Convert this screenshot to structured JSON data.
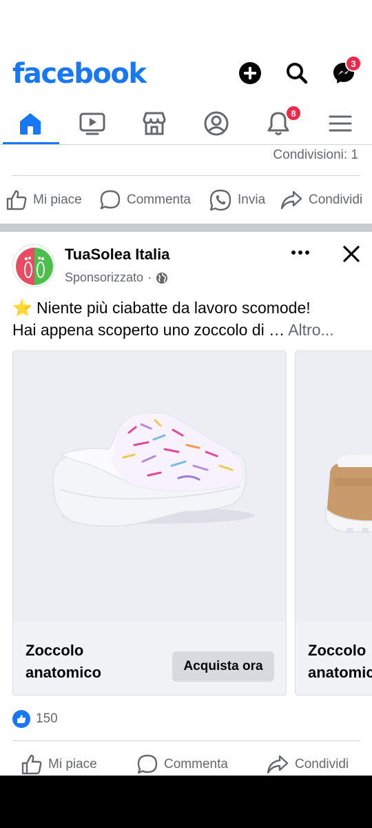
{
  "app": {
    "logo_text": "facebook",
    "brand_color": "#1877f2",
    "top_icons": [
      {
        "name": "create-post",
        "icon": "plus-circle-icon"
      },
      {
        "name": "search",
        "icon": "search-icon"
      },
      {
        "name": "messenger",
        "icon": "messenger-icon",
        "badge": "3"
      }
    ]
  },
  "nav": {
    "tabs": [
      {
        "name": "home",
        "icon": "home-icon",
        "active": true
      },
      {
        "name": "video",
        "icon": "video-icon"
      },
      {
        "name": "marketplace",
        "icon": "marketplace-icon"
      },
      {
        "name": "profile",
        "icon": "profile-icon"
      },
      {
        "name": "notifications",
        "icon": "bell-icon",
        "badge": "8"
      },
      {
        "name": "menu",
        "icon": "menu-icon"
      }
    ]
  },
  "previous_post": {
    "shares_text": "Condivisioni: 1",
    "actions": {
      "like": "Mi piace",
      "comment": "Commenta",
      "send": "Invia",
      "share": "Condividi"
    }
  },
  "post": {
    "page_name": "TuaSolea Italia",
    "sponsored_label": "Sponsorizzato",
    "sponsored_separator": "·",
    "text_emoji": "⭐",
    "text_line1": "Niente più ciabatte da lavoro scomode!",
    "text_line2": "Hai appena scoperto uno zoccolo di …",
    "see_more": "Altro...",
    "cards": [
      {
        "title": "Zoccolo\nanatomico",
        "cta": "Acquista ora"
      },
      {
        "title": "Zoccolo\nanatomico"
      }
    ],
    "reaction_count": "150",
    "actions": {
      "like": "Mi piace",
      "comment": "Commenta",
      "share": "Condividi"
    }
  },
  "colors": {
    "notification_badge": "#f02849",
    "secondary_text": "#65676b",
    "separator": "#c9ccd1"
  }
}
